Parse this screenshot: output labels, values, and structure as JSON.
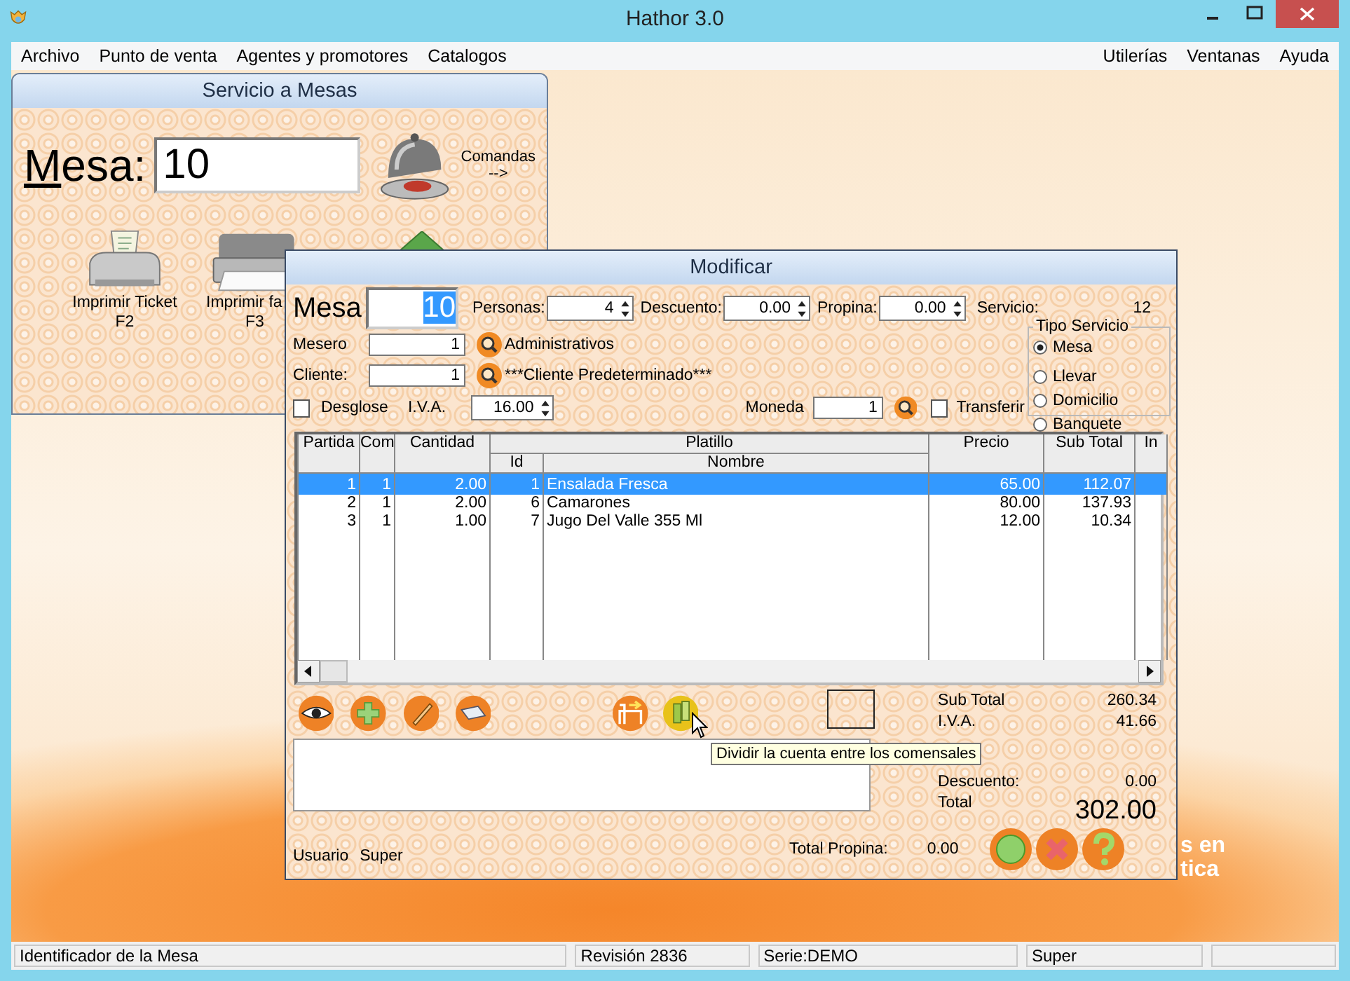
{
  "window": {
    "title": "Hathor 3.0"
  },
  "menu": {
    "left": [
      "Archivo",
      "Punto de venta",
      "Agentes y promotores",
      "Catalogos"
    ],
    "right": [
      "Utilerías",
      "Ventanas",
      "Ayuda"
    ]
  },
  "servicio_a_mesas": {
    "title": "Servicio a Mesas",
    "mesa_label": "Mesa:",
    "mesa_value": "10",
    "comandas": [
      "Comandas",
      "-->"
    ],
    "actions": [
      {
        "label": "Imprimir Ticket",
        "key": "F2"
      },
      {
        "label": "Imprimir fa",
        "key": "F3"
      }
    ]
  },
  "modificar": {
    "title": "Modificar",
    "mesa": {
      "label": "Mesa",
      "value": "10",
      "highlighted": true
    },
    "spinners": [
      {
        "label": "Personas:",
        "value": "4"
      },
      {
        "label": "Descuento:",
        "value": "0.00"
      },
      {
        "label": "Propina:",
        "value": "0.00"
      }
    ],
    "servicio": {
      "label": "Servicio:",
      "value": "12"
    },
    "mesero": {
      "label": "Mesero",
      "value": "1",
      "name": "Administrativos"
    },
    "cliente": {
      "label": "Cliente:",
      "value": "1",
      "name": "***Cliente Predeterminado***"
    },
    "desglose": {
      "label": "Desglose",
      "checked": false
    },
    "iva": {
      "label": "I.V.A.",
      "value": "16.00"
    },
    "moneda": {
      "label": "Moneda",
      "value": "1"
    },
    "transferir": {
      "label": "Transferir",
      "checked": false
    },
    "tipo_servicio": {
      "title": "Tipo Servicio",
      "options": [
        {
          "label": "Mesa",
          "selected": true
        },
        {
          "label": "Llevar",
          "selected": false
        },
        {
          "label": "Domicilio",
          "selected": false
        },
        {
          "label": "Banquete",
          "selected": false
        }
      ]
    },
    "table": {
      "group_header": "Platillo",
      "columns": [
        "Partida",
        "Com",
        "Cantidad",
        "Id",
        "Nombre",
        "Precio",
        "Sub Total",
        "In"
      ],
      "rows": [
        {
          "cells": [
            "1",
            "1",
            "2.00",
            "1",
            "Ensalada Fresca",
            "65.00",
            "112.07"
          ],
          "selected": true
        },
        {
          "cells": [
            "2",
            "1",
            "2.00",
            "6",
            "Camarones",
            "80.00",
            "137.93"
          ],
          "selected": false
        },
        {
          "cells": [
            "3",
            "1",
            "1.00",
            "7",
            "Jugo Del Valle 355 Ml",
            "12.00",
            "10.34"
          ],
          "selected": false
        }
      ]
    },
    "tooltip": "Dividir la cuenta entre los comensales",
    "totals": [
      {
        "label": "Sub Total",
        "value": "260.34",
        "kind": "line"
      },
      {
        "label": "I.V.A.",
        "value": "41.66",
        "kind": "line"
      },
      {
        "label": "Descuento:",
        "value": "0.00",
        "kind": "line"
      },
      {
        "label": "Total",
        "value": "302.00",
        "kind": "grand"
      }
    ],
    "usuario": {
      "label": "Usuario",
      "value": "Super"
    },
    "total_propina": {
      "label": "Total Propina:",
      "value": "0.00"
    }
  },
  "background_logo": [
    "s en",
    "tica"
  ],
  "status_bar": [
    "Identificador de la Mesa",
    "Revisión 2836",
    "Serie:DEMO",
    "Super"
  ]
}
